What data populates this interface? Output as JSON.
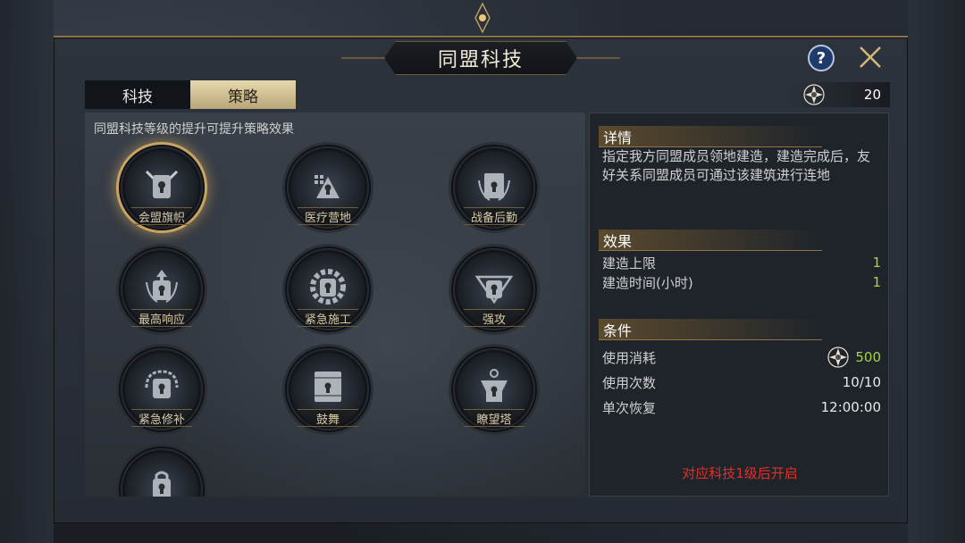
{
  "header": {
    "title": "同盟科技",
    "help_label": "?"
  },
  "tabs": [
    {
      "label": "科技",
      "active": false
    },
    {
      "label": "策略",
      "active": true
    }
  ],
  "currency": {
    "icon": "alliance-star-icon",
    "value": "20"
  },
  "left": {
    "description": "同盟科技等级的提升可提升策略效果",
    "nodes": [
      {
        "label": "会盟旗帜",
        "icon": "banner-emblem-icon",
        "selected": true
      },
      {
        "label": "医疗营地",
        "icon": "medical-camp-emblem-icon"
      },
      {
        "label": "战备后勤",
        "icon": "logistics-emblem-icon"
      },
      {
        "label": "最高响应",
        "icon": "response-emblem-icon"
      },
      {
        "label": "紧急施工",
        "icon": "gear-emblem-icon"
      },
      {
        "label": "强攻",
        "icon": "assault-emblem-icon"
      },
      {
        "label": "紧急修补",
        "icon": "repair-emblem-icon"
      },
      {
        "label": "鼓舞",
        "icon": "drum-emblem-icon"
      },
      {
        "label": "瞭望塔",
        "icon": "watchtower-emblem-icon"
      },
      {
        "label": "",
        "icon": "locked-emblem-icon"
      }
    ]
  },
  "detail": {
    "details_head": "详情",
    "details_text": "指定我方同盟成员领地建造，建造完成后，友好关系同盟成员可通过该建筑进行连地",
    "effects_head": "效果",
    "effects": [
      {
        "key": "建造上限",
        "value": "1"
      },
      {
        "key": "建造时间(小时)",
        "value": "1"
      }
    ],
    "conditions_head": "条件",
    "conditions": {
      "cost_label": "使用消耗",
      "cost_value": "500",
      "uses_label": "使用次数",
      "uses_value": "10/10",
      "recover_label": "单次恢复",
      "recover_value": "12:00:00"
    },
    "unlock_note": "对应科技1级后开启"
  },
  "colors": {
    "accent_gold": "#c8a463",
    "value_green": "#a6d24a",
    "warning_red": "#e0302a"
  }
}
